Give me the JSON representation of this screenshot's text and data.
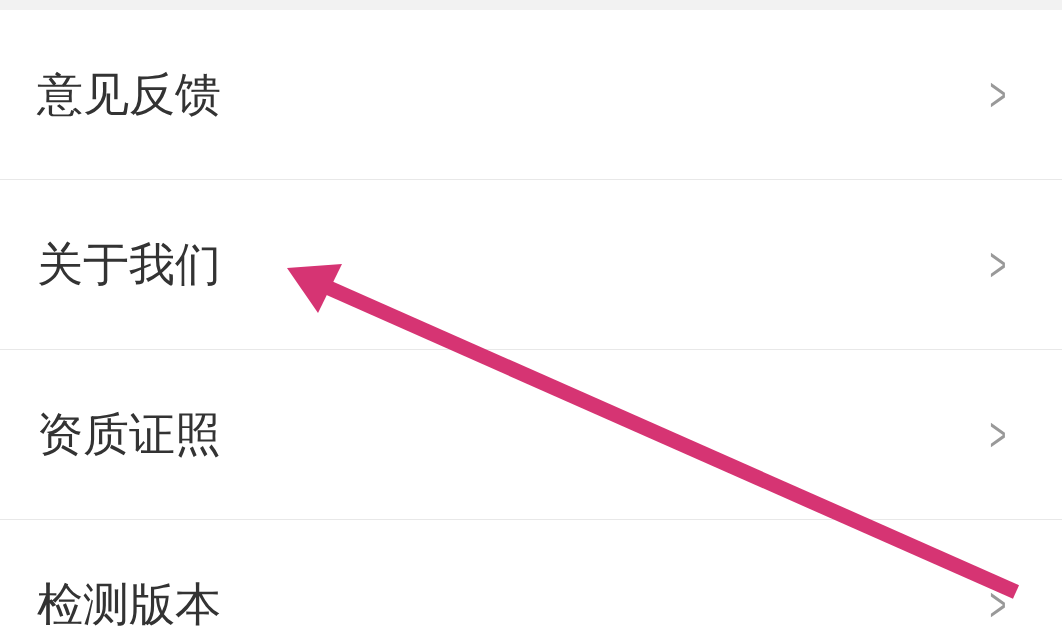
{
  "settings": {
    "items": [
      {
        "label": "意见反馈",
        "chevron": ">"
      },
      {
        "label": "关于我们",
        "chevron": ">"
      },
      {
        "label": "资质证照",
        "chevron": ">"
      },
      {
        "label": "检测版本",
        "chevron": ">"
      }
    ]
  }
}
